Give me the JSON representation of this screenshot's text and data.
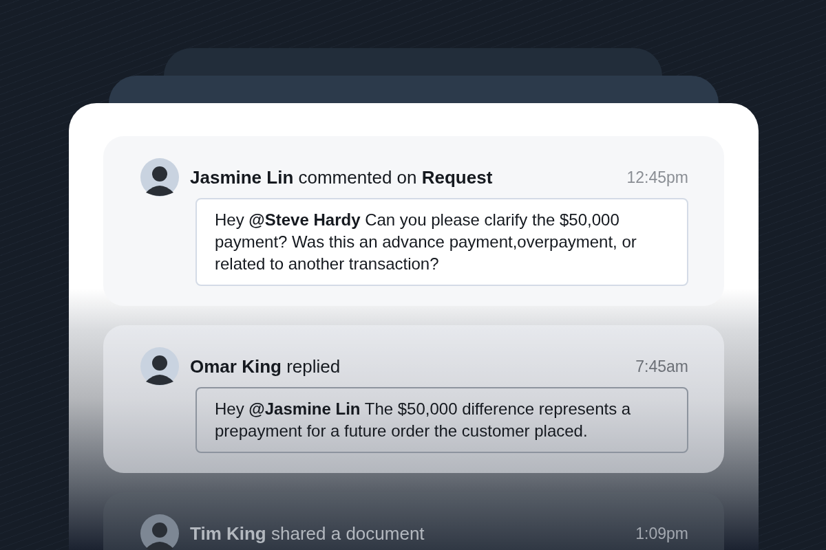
{
  "activity": [
    {
      "headline": "**Jasmine Lin** commented on **Request**",
      "time": "12:45pm",
      "message": "Hey **@Steve Hardy** Can you please clarify the $50,000 payment? Was this an advance payment,overpayment, or related to another transaction?"
    },
    {
      "headline": "**Omar King** replied",
      "time": "7:45am",
      "message": "Hey **@Jasmine Lin** The $50,000 difference represents a prepayment for a future order the customer placed."
    },
    {
      "headline": "**Tim King** shared a document",
      "time": "1:09pm"
    }
  ]
}
